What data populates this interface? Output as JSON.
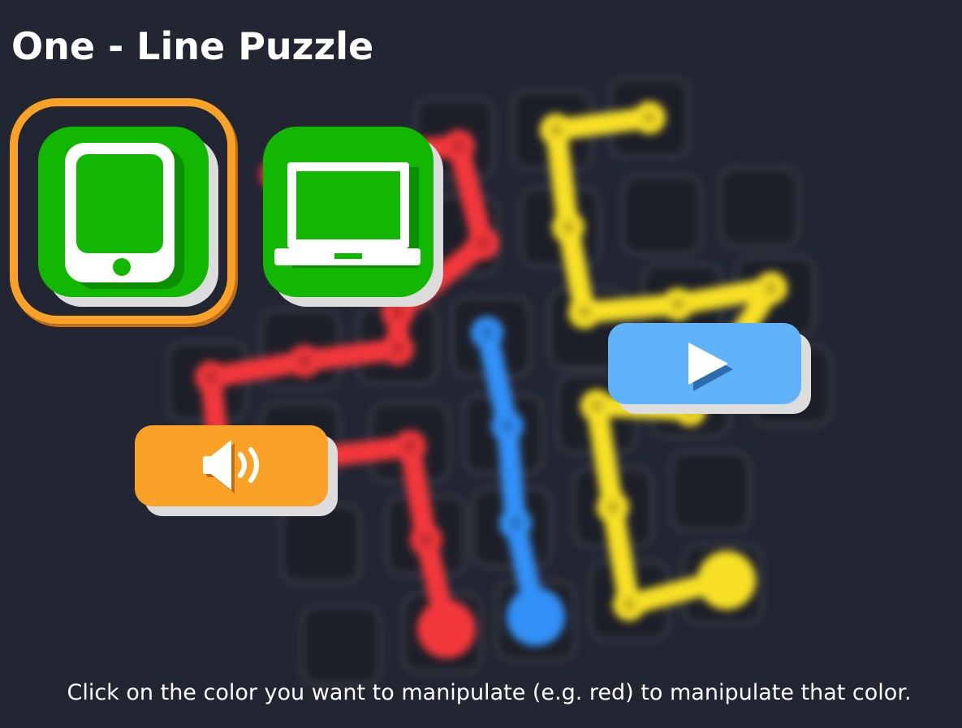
{
  "title": "One - Line Puzzle",
  "hint": "Click on the color you want to manipulate (e.g. red) to manipulate that color.",
  "colors": {
    "background": "#222532",
    "green": "#11b700",
    "orange": "#f9a227",
    "blue_button": "#60b2f9",
    "red_line": "#f2373b",
    "blue_line": "#3290f7",
    "yellow_line": "#f7df25"
  },
  "buttons": {
    "tablet": {
      "icon": "tablet-icon",
      "selected": true
    },
    "laptop": {
      "icon": "laptop-icon",
      "selected": false
    },
    "play": {
      "icon": "play-icon"
    },
    "sound": {
      "icon": "speaker-icon"
    }
  }
}
